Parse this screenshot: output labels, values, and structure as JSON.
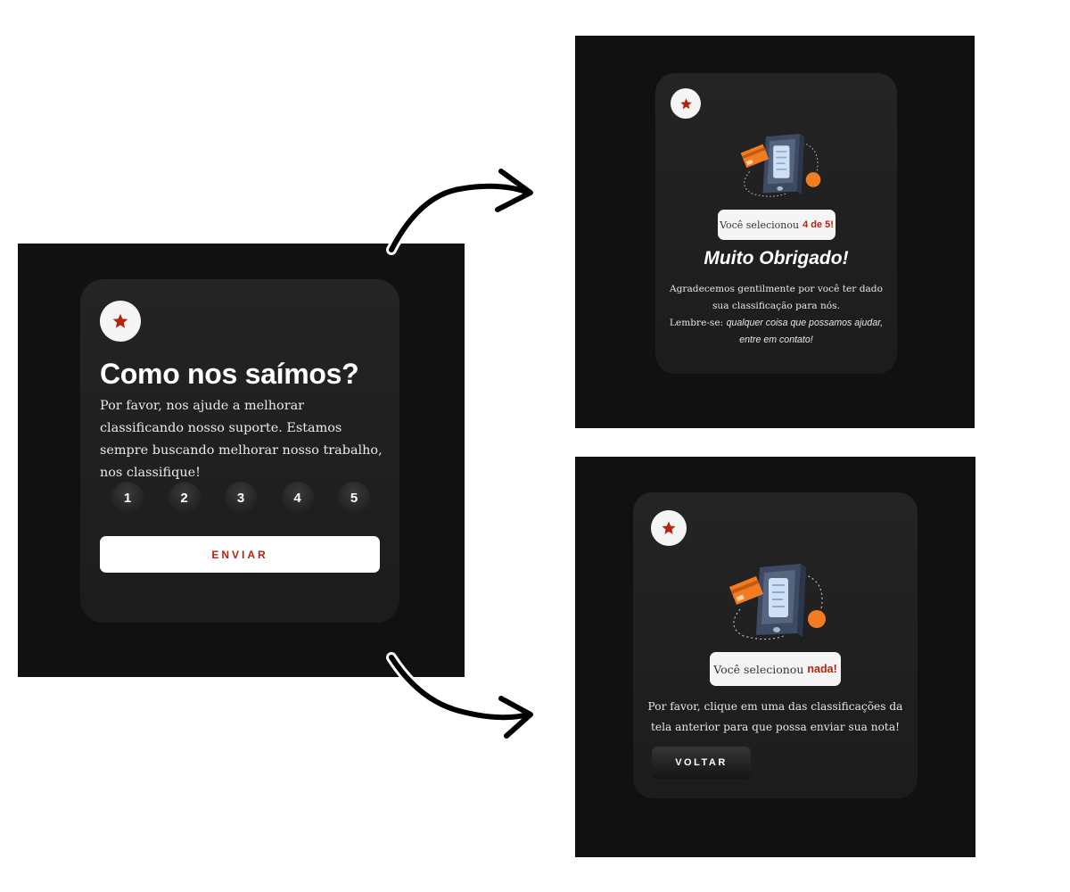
{
  "main": {
    "title": "Como nos saímos?",
    "description": "Por favor, nos ajude a melhorar classificando nosso suporte. Estamos sempre buscando melhorar nosso trabalho, nos classifique!",
    "ratings": [
      "1",
      "2",
      "3",
      "4",
      "5"
    ],
    "submit_label": "ENVIAR"
  },
  "thanks": {
    "selected_prefix": "Você selecionou",
    "selected_value": "4 de 5!",
    "title": "Muito Obrigado!",
    "body": "Agradecemos gentilmente por você ter dado sua classificação para nós.",
    "remember_prefix": "Lembre-se:",
    "remember_text": "qualquer coisa que possamos ajudar, entre em contato!"
  },
  "none": {
    "selected_prefix": "Você selecionou",
    "selected_value": "nada!",
    "body": "Por favor, clique em uma das classificações da tela anterior para que possa enviar sua nota!",
    "back_label": "VOLTAR"
  },
  "colors": {
    "accent": "#b5220f",
    "panel_bg": "#111111",
    "card_bg": "#222222",
    "illustration_orange": "#f47c20"
  },
  "icons": {
    "badge": "star-icon",
    "illustration": "phone-payment-illustration",
    "flow": "curved-arrow-icon"
  }
}
